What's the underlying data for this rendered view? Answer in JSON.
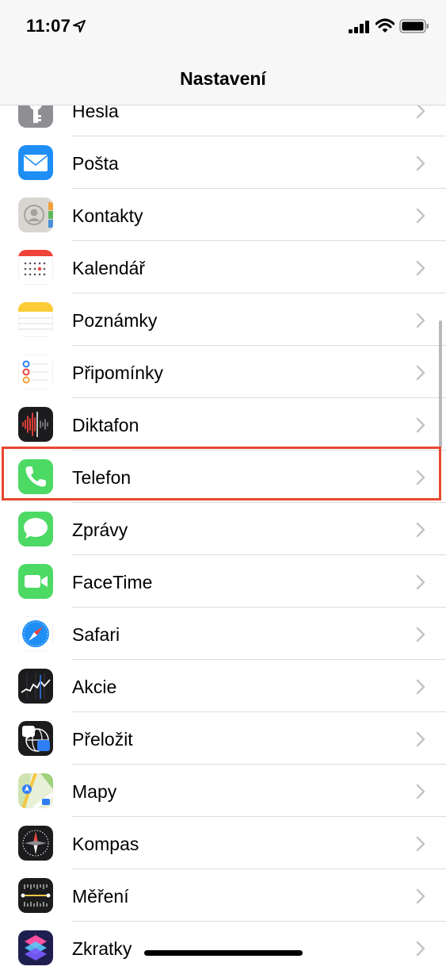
{
  "status_bar": {
    "time": "11:07",
    "icons": [
      "location-arrow-icon",
      "cellular-signal-icon",
      "wifi-icon",
      "battery-icon"
    ]
  },
  "nav": {
    "title": "Nastavení"
  },
  "items": [
    {
      "label": "Hesla",
      "icon": "key-icon"
    },
    {
      "label": "Pošta",
      "icon": "mail-icon"
    },
    {
      "label": "Kontakty",
      "icon": "contacts-icon"
    },
    {
      "label": "Kalendář",
      "icon": "calendar-icon"
    },
    {
      "label": "Poznámky",
      "icon": "notes-icon"
    },
    {
      "label": "Připomínky",
      "icon": "reminders-icon"
    },
    {
      "label": "Diktafon",
      "icon": "voice-memos-icon"
    },
    {
      "label": "Telefon",
      "icon": "phone-icon",
      "highlighted": true
    },
    {
      "label": "Zprávy",
      "icon": "messages-icon"
    },
    {
      "label": "FaceTime",
      "icon": "facetime-icon"
    },
    {
      "label": "Safari",
      "icon": "safari-compass-icon"
    },
    {
      "label": "Akcie",
      "icon": "stocks-icon"
    },
    {
      "label": "Přeložit",
      "icon": "translate-icon"
    },
    {
      "label": "Mapy",
      "icon": "maps-icon"
    },
    {
      "label": "Kompas",
      "icon": "compass-icon"
    },
    {
      "label": "Měření",
      "icon": "measure-icon"
    },
    {
      "label": "Zkratky",
      "icon": "shortcuts-icon"
    }
  ],
  "colors": {
    "highlight_border": "#e8482f",
    "separator": "#dcdce0",
    "chevron": "#c4c4c7"
  }
}
